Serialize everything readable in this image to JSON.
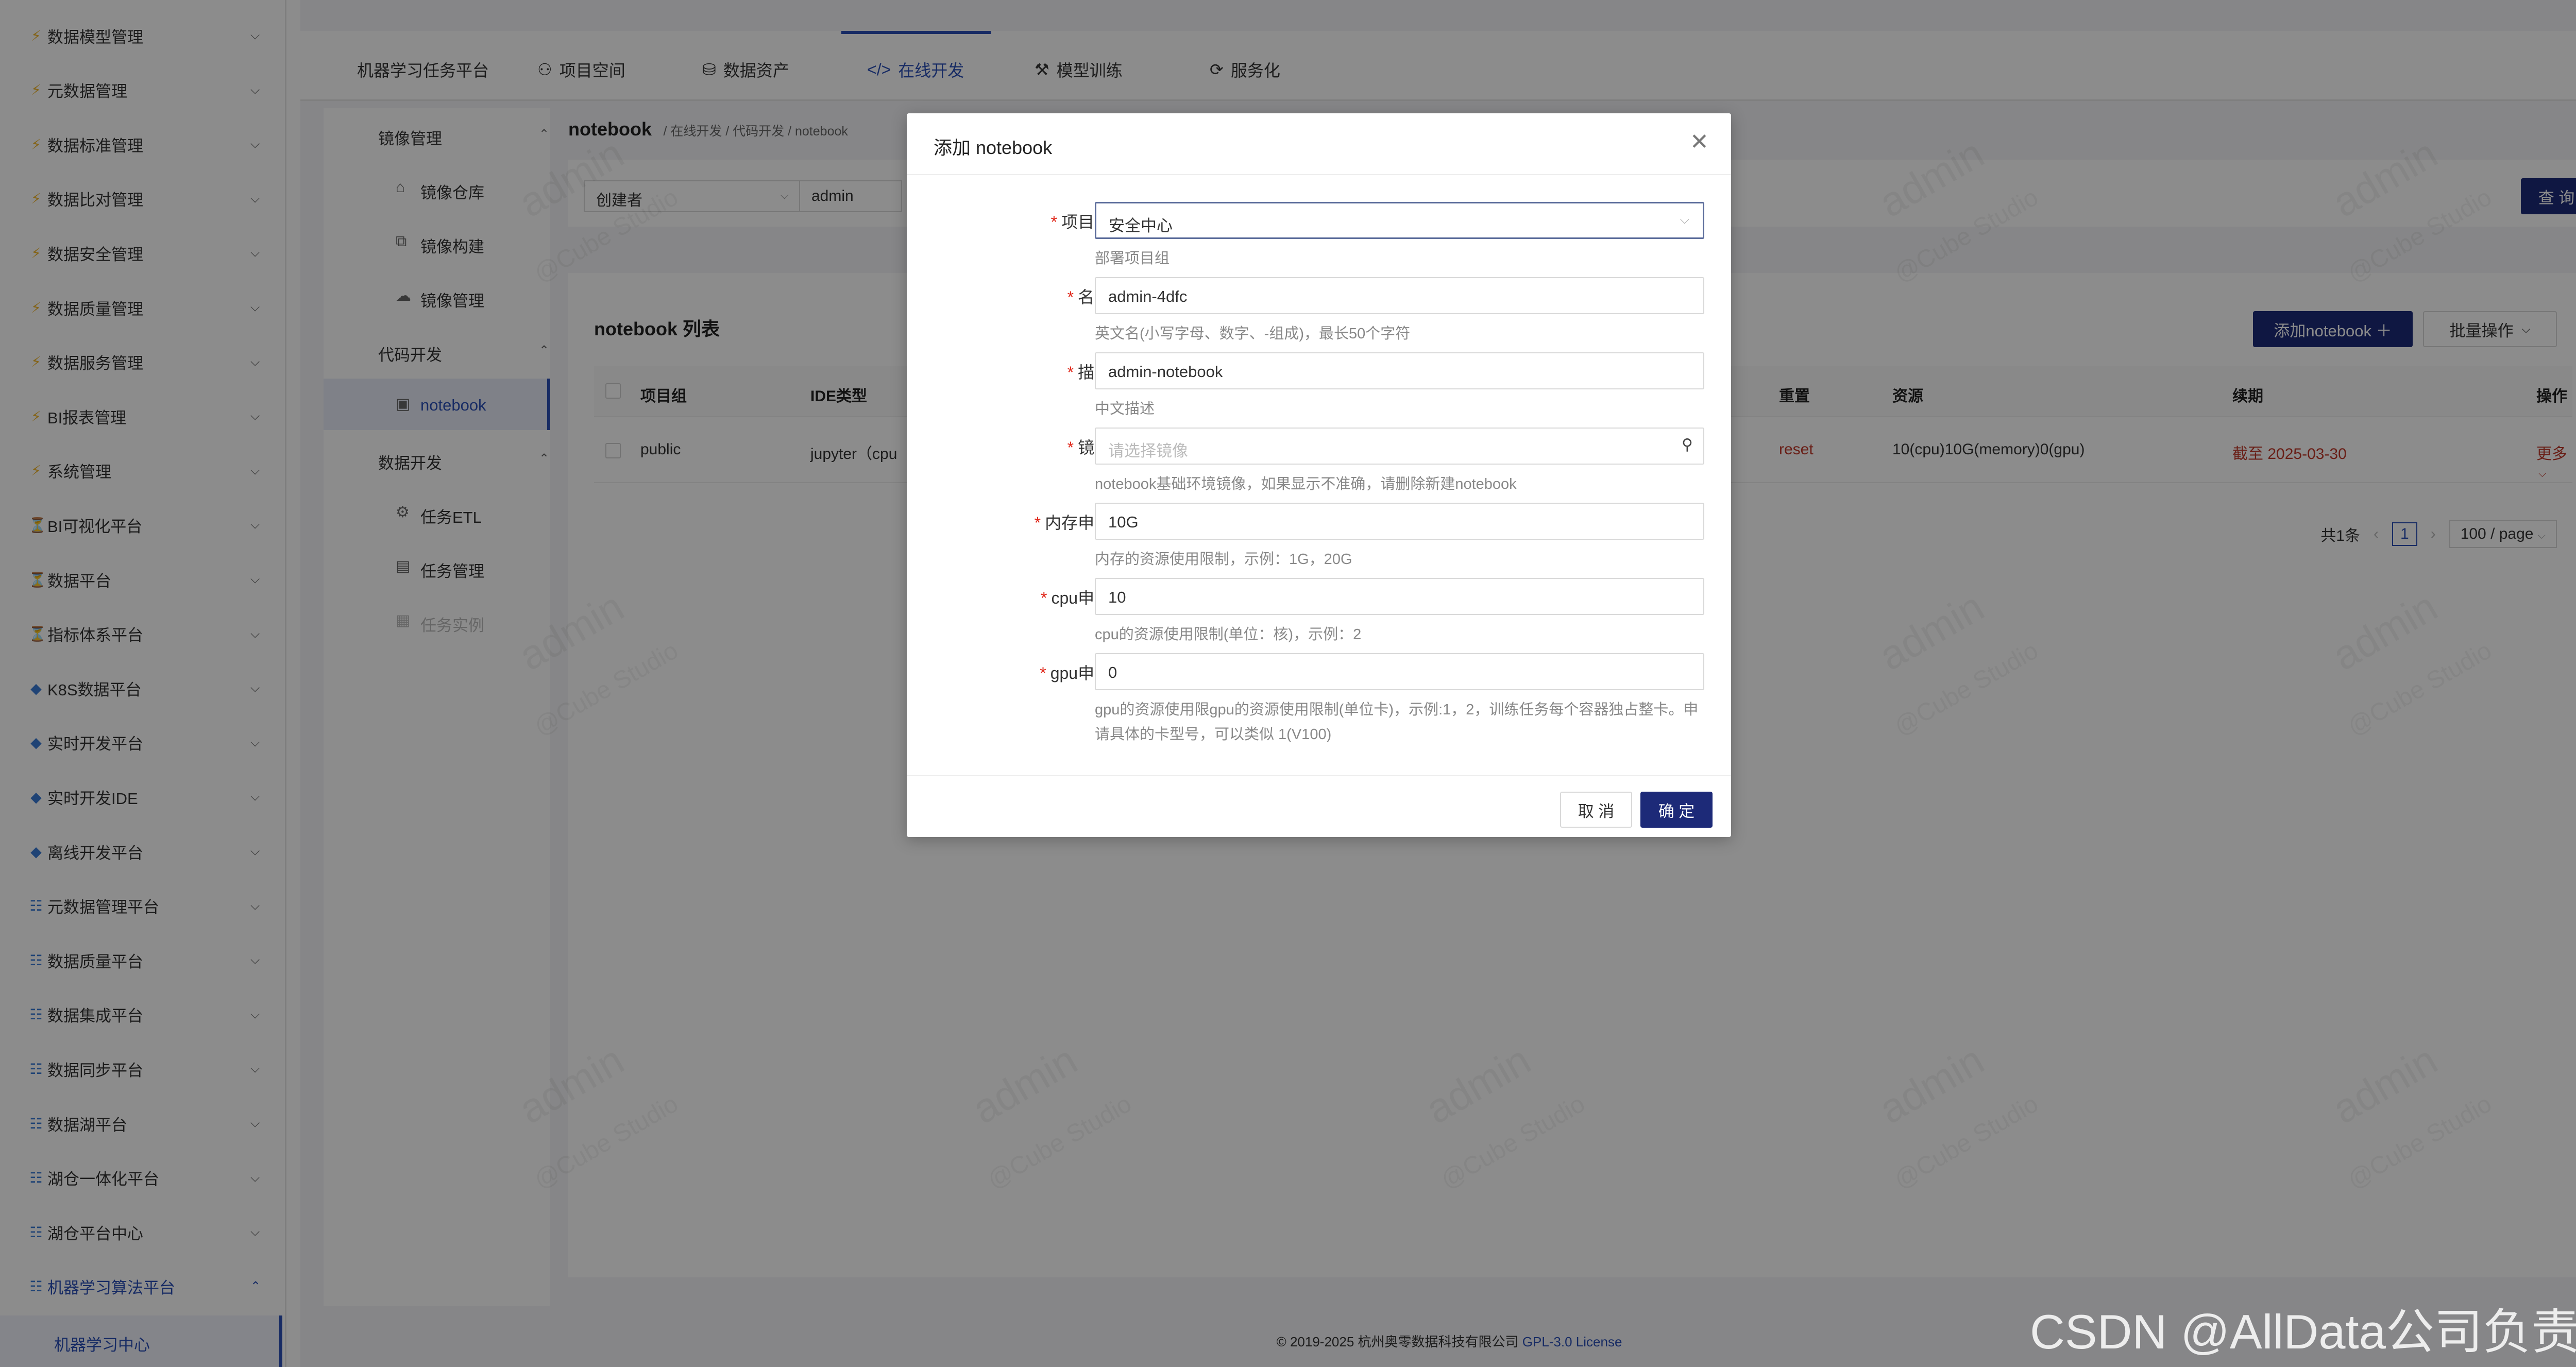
{
  "sidebar": {
    "items": [
      {
        "label": "数据模型管理",
        "icon": "bolt-icon",
        "glyph": "⚡"
      },
      {
        "label": "元数据管理",
        "icon": "bolt-icon",
        "glyph": "⚡"
      },
      {
        "label": "数据标准管理",
        "icon": "bolt-icon",
        "glyph": "⚡"
      },
      {
        "label": "数据比对管理",
        "icon": "bolt-icon",
        "glyph": "⚡"
      },
      {
        "label": "数据安全管理",
        "icon": "bolt-icon",
        "glyph": "⚡"
      },
      {
        "label": "数据质量管理",
        "icon": "bolt-icon",
        "glyph": "⚡"
      },
      {
        "label": "数据服务管理",
        "icon": "bolt-icon",
        "glyph": "⚡"
      },
      {
        "label": "BI报表管理",
        "icon": "bolt-icon",
        "glyph": "⚡"
      },
      {
        "label": "系统管理",
        "icon": "bolt-icon",
        "glyph": "⚡"
      },
      {
        "label": "BI可视化平台",
        "icon": "hourglass-icon",
        "glyph": "⏳"
      },
      {
        "label": "数据平台",
        "icon": "hourglass-icon",
        "glyph": "⏳"
      },
      {
        "label": "指标体系平台",
        "icon": "hourglass-icon",
        "glyph": "⏳"
      },
      {
        "label": "K8S数据平台",
        "icon": "gem-icon",
        "glyph": "◆"
      },
      {
        "label": "实时开发平台",
        "icon": "gem-icon",
        "glyph": "◆"
      },
      {
        "label": "实时开发IDE",
        "icon": "gem-icon",
        "glyph": "◆"
      },
      {
        "label": "离线开发平台",
        "icon": "gem-icon",
        "glyph": "◆"
      },
      {
        "label": "元数据管理平台",
        "icon": "grid-icon",
        "glyph": "☷"
      },
      {
        "label": "数据质量平台",
        "icon": "grid-icon",
        "glyph": "☷"
      },
      {
        "label": "数据集成平台",
        "icon": "grid-icon",
        "glyph": "☷"
      },
      {
        "label": "数据同步平台",
        "icon": "grid-icon",
        "glyph": "☷"
      },
      {
        "label": "数据湖平台",
        "icon": "grid-icon",
        "glyph": "☷"
      },
      {
        "label": "湖仓一体化平台",
        "icon": "grid-icon",
        "glyph": "☷"
      },
      {
        "label": "湖仓平台中心",
        "icon": "grid-icon",
        "glyph": "☷"
      },
      {
        "label": "机器学习算法平台",
        "icon": "grid-icon",
        "glyph": "☷",
        "active": true
      }
    ],
    "sub_active": "机器学习中心"
  },
  "topnav": {
    "items": [
      {
        "label": "机器学习任务平台",
        "glyph": ""
      },
      {
        "label": "项目空间",
        "glyph": "⚇"
      },
      {
        "label": "数据资产",
        "glyph": "⛁"
      },
      {
        "label": "在线开发",
        "glyph": "</>"
      },
      {
        "label": "模型训练",
        "glyph": "⚒"
      },
      {
        "label": "服务化",
        "glyph": "⟳"
      }
    ]
  },
  "subnav": {
    "group1": "镜像管理",
    "g1_items": [
      {
        "label": "镜像仓库",
        "glyph": "⌂"
      },
      {
        "label": "镜像构建",
        "glyph": "⧉"
      },
      {
        "label": "镜像管理",
        "glyph": "☁"
      }
    ],
    "group2": "代码开发",
    "g2_items": [
      {
        "label": "notebook",
        "glyph": "▣"
      }
    ],
    "group3": "数据开发",
    "g3_items": [
      {
        "label": "任务ETL",
        "glyph": "⚙"
      },
      {
        "label": "任务管理",
        "glyph": "▤"
      },
      {
        "label": "任务实例",
        "glyph": "▦"
      }
    ]
  },
  "breadcrumb": {
    "title": "notebook",
    "path": "/ 在线开发 / 代码开发 / notebook"
  },
  "filter": {
    "field": "创建者",
    "value": "admin",
    "query_label": "查 询"
  },
  "table": {
    "title": "notebook 列表",
    "add_label": "添加notebook ＋",
    "batch_label": "批量操作",
    "columns": [
      "项目组",
      "IDE类型",
      "重置",
      "资源",
      "续期",
      "操作"
    ],
    "row": {
      "group": "public",
      "ide": "jupyter（cpu",
      "reset": "reset",
      "resource": "10(cpu)10G(memory)0(gpu)",
      "renew": "截至 2025-03-30",
      "more": "更多"
    },
    "pager": {
      "total": "共1条",
      "page": "1",
      "size": "100 / page"
    }
  },
  "footer": {
    "copyright": "© 2019-2025 杭州奥零数据科技有限公司",
    "license": "GPL-3.0 License"
  },
  "modal": {
    "title": "添加 notebook",
    "fields": [
      {
        "label": "项目组:",
        "value": "安全中心",
        "help": "部署项目组"
      },
      {
        "label": "名称:",
        "value": "admin-4dfc",
        "help": "英文名(小写字母、数字、-组成)，最长50个字符"
      },
      {
        "label": "描述:",
        "value": "admin-notebook",
        "help": "中文描述"
      },
      {
        "label": "镜像:",
        "placeholder": "请选择镜像",
        "help": "notebook基础环境镜像，如果显示不准确，请删除新建notebook"
      },
      {
        "label": "内存申请:",
        "value": "10G",
        "help": "内存的资源使用限制，示例：1G，20G"
      },
      {
        "label": "cpu申请:",
        "value": "10",
        "help": "cpu的资源使用限制(单位：核)，示例：2"
      },
      {
        "label": "gpu申请:",
        "value": "0",
        "help": "gpu的资源使用限gpu的资源使用限制(单位卡)，示例:1，2，训练任务每个容器独占整卡。申请具体的卡型号，可以类似 1(V100)"
      }
    ],
    "cancel_label": "取 消",
    "ok_label": "确 定"
  },
  "watermark": {
    "name": "admin",
    "studio": "@Cube Studio"
  },
  "csdn": "CSDN @AllData公司负责人",
  "colors": {
    "primary": "#1d2a78",
    "accent": "#2b4fb6",
    "required": "#e0281b",
    "danger": "#c0392b"
  }
}
